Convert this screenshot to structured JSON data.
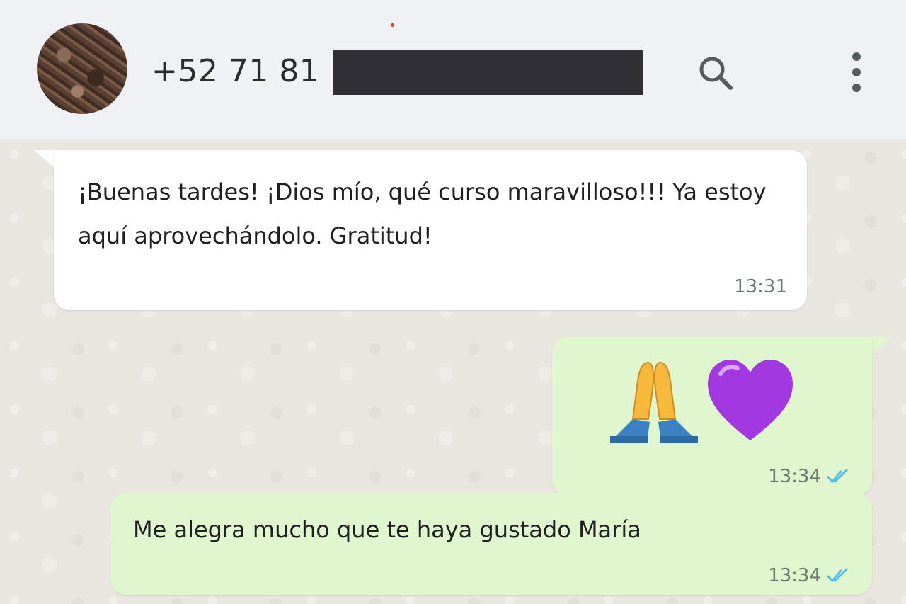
{
  "header": {
    "contact_phone_visible": "+52 71 81",
    "redacted": true,
    "icons": [
      "avatar",
      "search-icon",
      "more-options-icon"
    ]
  },
  "messages": [
    {
      "direction": "incoming",
      "text": "¡Buenas tardes! ¡Dios mío, qué curso maravilloso!!! Ya estoy aquí aprovechándolo. Gratitud!",
      "time": "13:31"
    },
    {
      "direction": "outgoing",
      "emojis": [
        "folded-hands",
        "purple-heart"
      ],
      "time": "13:34",
      "status": "read"
    },
    {
      "direction": "outgoing",
      "text": "Me alegra mucho que te haya gustado María",
      "time": "13:34",
      "status": "read"
    }
  ],
  "colors": {
    "header_bg": "#f0f1f5",
    "incoming_bubble": "#ffffff",
    "outgoing_bubble": "#e0f6cf",
    "read_check": "#53bdeb"
  }
}
